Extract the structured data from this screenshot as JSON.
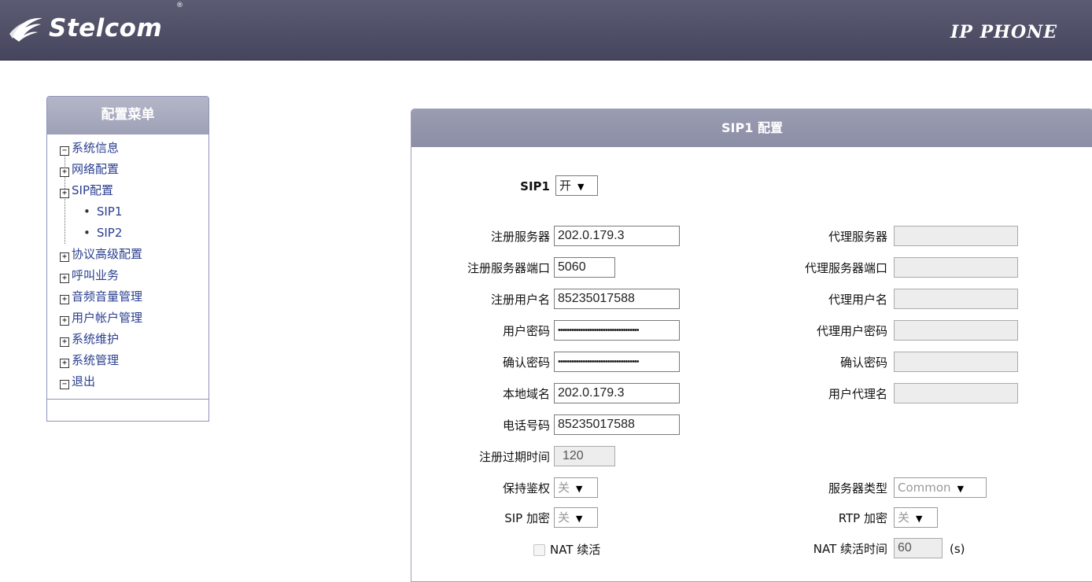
{
  "header": {
    "brand": "Stelcom",
    "reg_mark": "®",
    "product": "IP PHONE"
  },
  "menu": {
    "title": "配置菜单",
    "items": [
      {
        "label": "系统信息",
        "box": "−"
      },
      {
        "label": "网络配置",
        "box": "+"
      },
      {
        "label": "SIP配置",
        "box": "+"
      },
      {
        "label": "SIP1"
      },
      {
        "label": "SIP2"
      },
      {
        "label": "协议高级配置",
        "box": "+"
      },
      {
        "label": "呼叫业务",
        "box": "+"
      },
      {
        "label": "音频音量管理",
        "box": "+"
      },
      {
        "label": "用户帐户管理",
        "box": "+"
      },
      {
        "label": "系统维护",
        "box": "+"
      },
      {
        "label": "系统管理",
        "box": "+"
      },
      {
        "label": "退出",
        "box": "−"
      }
    ]
  },
  "panel": {
    "title": "SIP1 配置",
    "sip1": {
      "label": "SIP1",
      "value": "开"
    },
    "left": {
      "reg_server": {
        "label": "注册服务器",
        "value": "202.0.179.3"
      },
      "reg_port": {
        "label": "注册服务器端口",
        "value": "5060"
      },
      "reg_user": {
        "label": "注册用户名",
        "value": "85235017588"
      },
      "user_pwd": {
        "label": "用户密码",
        "value": "••••••••••••••••••••••••••••••••••••"
      },
      "confirm_pwd": {
        "label": "确认密码",
        "value": "••••••••••••••••••••••••••••••••••••"
      },
      "local_domain": {
        "label": "本地域名",
        "value": "202.0.179.3"
      },
      "phone": {
        "label": "电话号码",
        "value": "85235017588"
      },
      "expire": {
        "label": "注册过期时间",
        "value": "120"
      },
      "keep_auth": {
        "label": "保持鉴权",
        "value": "关"
      },
      "sip_enc": {
        "label": "SIP 加密",
        "value": "关"
      },
      "nat_keepalive": {
        "label": "NAT 续活"
      }
    },
    "right": {
      "proxy_server": {
        "label": "代理服务器",
        "value": ""
      },
      "proxy_port": {
        "label": "代理服务器端口",
        "value": ""
      },
      "proxy_user": {
        "label": "代理用户名",
        "value": ""
      },
      "proxy_pwd": {
        "label": "代理用户密码",
        "value": ""
      },
      "confirm_pwd": {
        "label": "确认密码",
        "value": ""
      },
      "user_agent": {
        "label": "用户代理名",
        "value": ""
      },
      "server_type": {
        "label": "服务器类型",
        "value": "Common"
      },
      "rtp_enc": {
        "label": "RTP 加密",
        "value": "关"
      },
      "nat_time": {
        "label": "NAT 续活时间",
        "value": "60",
        "unit": "(s)"
      }
    }
  }
}
